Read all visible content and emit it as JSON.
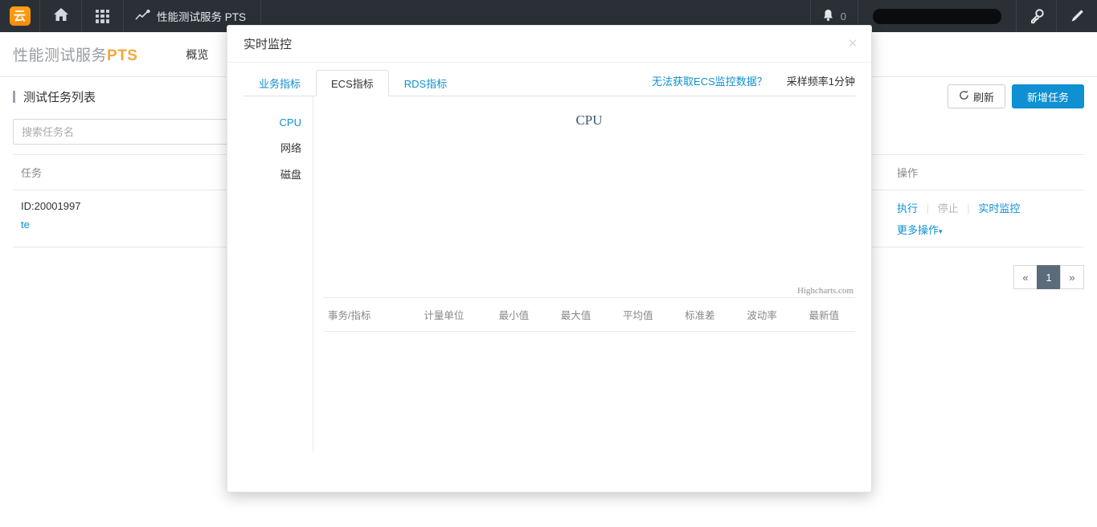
{
  "topbar": {
    "logo_icon": "aliyun-cloud-logo",
    "logo_glyph": "云",
    "home_icon": "home-icon",
    "apps_icon": "grid-apps-icon",
    "product_icon": "line-chart-icon",
    "product_name": "性能测试服务 PTS",
    "bell_icon": "bell-icon",
    "notification_count": "0",
    "account_label": "",
    "key_icon": "key-icon",
    "pencil_icon": "pencil-icon"
  },
  "page": {
    "brand_prefix": "性能测试服务",
    "brand_accent": "PTS",
    "nav": [
      {
        "label": "概览"
      }
    ],
    "section_title": "测试任务列表",
    "refresh_button": "刷新",
    "refresh_icon": "refresh-icon",
    "add_task_button": "新增任务",
    "search": {
      "placeholder": "搜索任务名",
      "value": ""
    },
    "table": {
      "headers": [
        "任务",
        "操作"
      ],
      "rows": [
        {
          "task_id": "ID:20001997",
          "task_name": "te",
          "ops": [
            "执行",
            "停止",
            "实时监控"
          ],
          "ops_disabled": [
            "停止"
          ],
          "more_label": "更多操作",
          "more_caret": "▾"
        }
      ]
    },
    "pagination": {
      "prev": "«",
      "pages": [
        "1"
      ],
      "current": "1",
      "next": "»"
    }
  },
  "modal": {
    "title": "实时监控",
    "close_icon": "close-icon",
    "close_glyph": "✕",
    "tabs": [
      {
        "label": "业务指标",
        "active": false
      },
      {
        "label": "ECS指标",
        "active": true
      },
      {
        "label": "RDS指标",
        "active": false
      }
    ],
    "hint_link": "无法获取ECS监控数据？",
    "sampling_text": "采样频率1分钟",
    "metric_nav": [
      {
        "label": "CPU",
        "active": true
      },
      {
        "label": "网络",
        "active": false
      },
      {
        "label": "磁盘",
        "active": false
      }
    ],
    "chart_credit": "Highcharts.com",
    "metric_table_headers": [
      "事务/指标",
      "计量单位",
      "最小值",
      "最大值",
      "平均值",
      "标准差",
      "波动率",
      "最新值"
    ],
    "metric_table_rows": []
  },
  "chart_data": {
    "type": "line",
    "title": "CPU",
    "subtitle": "",
    "xlabel": "",
    "ylabel": "",
    "categories": [],
    "series": [],
    "x": [],
    "values": [],
    "grid": false,
    "legend_position": "none",
    "credit": "Highcharts.com",
    "note": "empty chart — no monitoring data rendered"
  }
}
